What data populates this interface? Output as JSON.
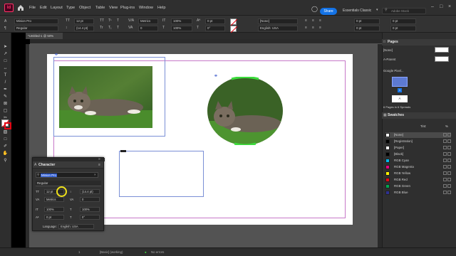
{
  "app": {
    "logo": "Id",
    "icon": "home-icon"
  },
  "menu": [
    "File",
    "Edit",
    "Layout",
    "Type",
    "Object",
    "Table",
    "View",
    "Plug-ins",
    "Window",
    "Help"
  ],
  "topbar": {
    "share": "Share",
    "workspace": "Essentials Classic",
    "search_placeholder": "Adobe Stock"
  },
  "control": {
    "font": "Minion Pro",
    "style": "Regular",
    "size": "12 pt",
    "leading": "(14.4 pt)",
    "kerning": "Metrics",
    "tracking": "0",
    "h_scale": "100%",
    "v_scale": "100%",
    "baseline": "0 pt",
    "skew": "0°",
    "paragraph_style": "[None]",
    "language": "English: USA",
    "indent1": "0 pt",
    "indent2": "0 pt",
    "indent3": "0 pt",
    "indent4": "0 pt"
  },
  "document": {
    "tab": "*Untitled-1 @ 50%"
  },
  "character_panel": {
    "title": "Character",
    "font": "Minion Pro",
    "style": "Regular",
    "size": "12 pt",
    "leading": "(14.4 pt)",
    "kerning": "Metrics",
    "tracking": "0",
    "v_scale": "100%",
    "h_scale": "100%",
    "baseline": "0 pt",
    "skew": "0°",
    "language_label": "Language:",
    "language": "English: USA"
  },
  "pages_panel": {
    "title": "Pages",
    "none": "[None]",
    "a_parent": "A-Parent",
    "layout_label": "Google Pixel...",
    "page_num": "1",
    "a_label": "A",
    "summary": "6 Pages in 6 Spreads"
  },
  "swatches_panel": {
    "title": "Swatches",
    "tint_label": "Tint:",
    "tint_value": "%",
    "items": [
      {
        "name": "[None]",
        "color": "#ffffff"
      },
      {
        "name": "[Registration]",
        "color": "#000000"
      },
      {
        "name": "[Paper]",
        "color": "#ffffff"
      },
      {
        "name": "[Black]",
        "color": "#000000"
      },
      {
        "name": "RGB Cyan",
        "color": "#00b7eb"
      },
      {
        "name": "RGB Magenta",
        "color": "#e6007e"
      },
      {
        "name": "RGB Yellow",
        "color": "#fff200"
      },
      {
        "name": "RGB Red",
        "color": "#e30613"
      },
      {
        "name": "RGB Green",
        "color": "#00a650"
      },
      {
        "name": "RGB Blue",
        "color": "#2e3192"
      }
    ]
  },
  "status": {
    "page": "1",
    "style": "[Basic] (working)",
    "errors": "No errors"
  },
  "colors": {
    "accent": "#1473e6",
    "frame_blue": "#7a8fd6",
    "margin": "#c678c8"
  }
}
